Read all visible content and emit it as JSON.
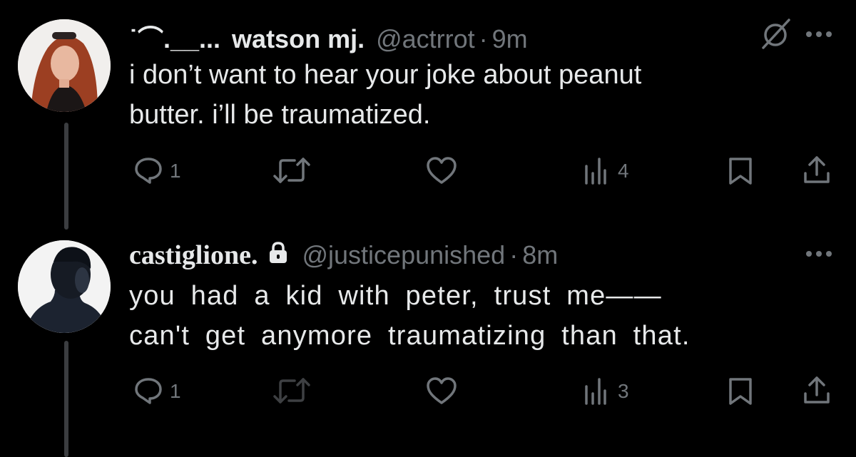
{
  "tweets": [
    {
      "decor_prefix": "˙⌒.__...",
      "name": "watson mj.",
      "handle": "@actrrot",
      "time": "9m",
      "text_line1": "i don’t want to hear your joke about peanut",
      "text_line2": "butter. i’ll be traumatized.",
      "replies": "1",
      "views": "4",
      "icons": [
        "reply-icon",
        "retweet-icon",
        "like-icon",
        "views-icon",
        "bookmark-icon",
        "share-icon",
        "grok-icon",
        "more-icon"
      ]
    },
    {
      "name": "castiglione.",
      "handle": "@justicepunished",
      "time": "8m",
      "text_line1": "you had a kid with peter, trust me——",
      "text_line2": "can't get anymore traumatizing than that.",
      "replies": "1",
      "views": "3",
      "icons": [
        "lock-icon",
        "reply-icon",
        "retweet-icon",
        "like-icon",
        "views-icon",
        "bookmark-icon",
        "share-icon",
        "more-icon"
      ]
    }
  ],
  "colors": {
    "background": "#000000",
    "text": "#e7e9ea",
    "muted": "#71767b",
    "thread": "#3b3d40"
  },
  "separator": "·"
}
